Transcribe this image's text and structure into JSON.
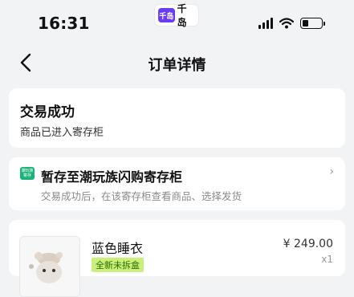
{
  "status_bar": {
    "time": "16:31",
    "app_logo_text": "千岛",
    "app_name": "千岛"
  },
  "nav": {
    "title": "订单详情"
  },
  "order_status": {
    "title": "交易成功",
    "subtitle": "商品已进入寄存柜"
  },
  "storage": {
    "icon_text_top": "潮玩族",
    "icon_text_bottom": "寄存",
    "title": "暂存至潮玩族闪购寄存柜",
    "description": "交易成功后，在该寄存柜查看商品、选择发货"
  },
  "product": {
    "name": "蓝色睡衣",
    "tag": "全新未拆盒",
    "price": "¥ 249.00",
    "quantity": "x1"
  },
  "colors": {
    "accent_purple": "#6a3df5",
    "storage_green": "#19b37a",
    "tag_green": "#c8f07a"
  }
}
